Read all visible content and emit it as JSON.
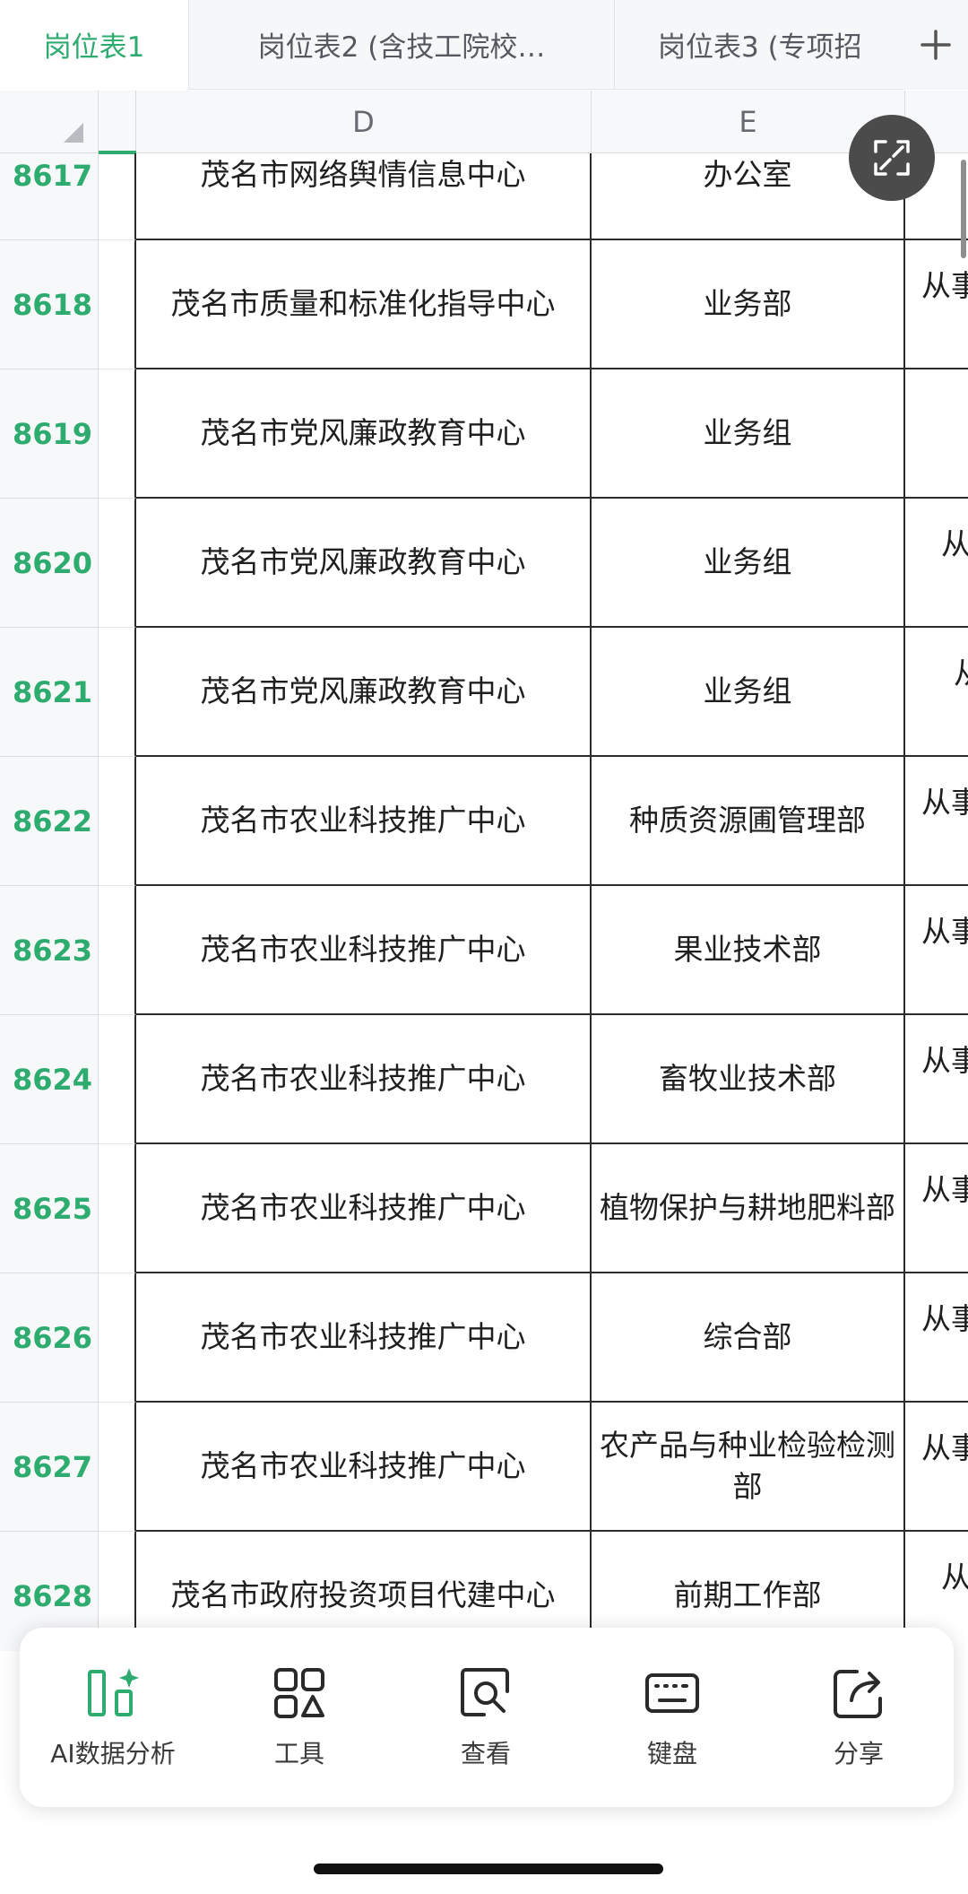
{
  "tabs": [
    {
      "label": "岗位表1",
      "active": true
    },
    {
      "label": "岗位表2 (含技工院校…",
      "active": false
    },
    {
      "label": "岗位表3 (专项招",
      "active": false
    }
  ],
  "columns": {
    "d": "D",
    "e": "E"
  },
  "rows": [
    {
      "num": "8617",
      "d": "茂名市网络舆情信息中心",
      "e": "办公室",
      "f": ""
    },
    {
      "num": "8618",
      "d": "茂名市质量和标准化指导中心",
      "e": "业务部",
      "f": "从事"
    },
    {
      "num": "8619",
      "d": "茂名市党风廉政教育中心",
      "e": "业务组",
      "f": ""
    },
    {
      "num": "8620",
      "d": "茂名市党风廉政教育中心",
      "e": "业务组",
      "f": "从"
    },
    {
      "num": "8621",
      "d": "茂名市党风廉政教育中心",
      "e": "业务组",
      "f": "从"
    },
    {
      "num": "8622",
      "d": "茂名市农业科技推广中心",
      "e": "种质资源圃管理部",
      "f": "从事"
    },
    {
      "num": "8623",
      "d": "茂名市农业科技推广中心",
      "e": "果业技术部",
      "f": "从事"
    },
    {
      "num": "8624",
      "d": "茂名市农业科技推广中心",
      "e": "畜牧业技术部",
      "f": "从事"
    },
    {
      "num": "8625",
      "d": "茂名市农业科技推广中心",
      "e": "植物保护与耕地肥料部",
      "f": "从事"
    },
    {
      "num": "8626",
      "d": "茂名市农业科技推广中心",
      "e": "综合部",
      "f": "从事"
    },
    {
      "num": "8627",
      "d": "茂名市农业科技推广中心",
      "e": "农产品与种业检验检测部",
      "f": "从事"
    },
    {
      "num": "8628",
      "d": "茂名市政府投资项目代建中心",
      "e": "前期工作部",
      "f": "从"
    }
  ],
  "toolbar": {
    "ai": "AI数据分析",
    "tools": "工具",
    "view": "查看",
    "keyboard": "键盘",
    "share": "分享"
  },
  "colors": {
    "accent": "#2eab6e",
    "grid": "#2b2b2b"
  }
}
